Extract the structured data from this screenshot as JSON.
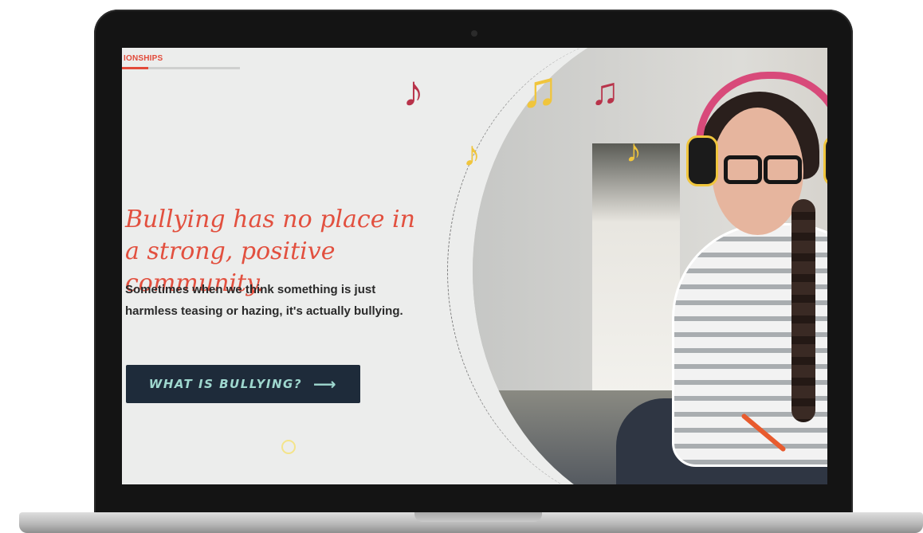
{
  "nav": {
    "section_label": "IONSHIPS",
    "progress_fraction": 0.22
  },
  "hero": {
    "headline": "Bullying has no place in a strong, positive community.",
    "body": "Sometimes when we think something is just harmless teasing or hazing, it's actually bullying.",
    "cta_label": "WHAT IS BULLYING?",
    "cta_icon": "arrow-right-icon"
  },
  "decor": {
    "notes": [
      "♪",
      "♫",
      "♪",
      "♫",
      "♪"
    ],
    "colors": {
      "accent": "#e2503f",
      "button": "#1e2b3a",
      "button_text": "#9fd8cf",
      "note_yellow": "#f0c53c",
      "note_red": "#b8334a"
    }
  }
}
